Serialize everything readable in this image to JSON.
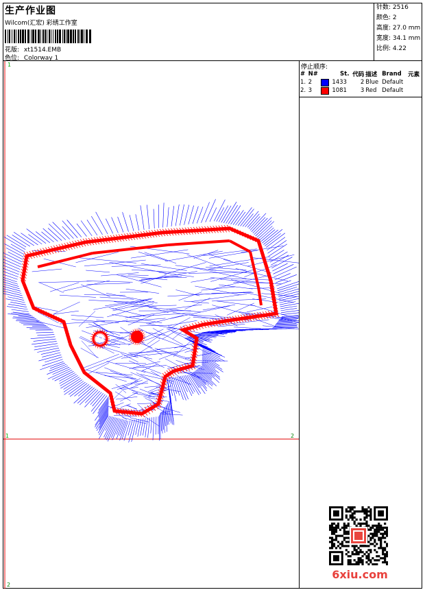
{
  "header": {
    "title": "生产作业图",
    "subtitle": "Wilcom(汇宏) 彩绣工作室",
    "design_label": "花版:",
    "design_value": "xt1514.EMB",
    "colorway_label": "色位:",
    "colorway_value": "Colorway 1"
  },
  "stats": {
    "stitches": "针数: 2516",
    "colors": "颜色: 2",
    "height": "高度: 27.0 mm",
    "width": "宽度: 34.1 mm",
    "ratio": "比例: 4.22"
  },
  "stop_sequence": {
    "caption": "停止顺序:",
    "headers": [
      "#",
      "N#",
      "St.",
      "代码",
      "描述",
      "Brand",
      "元素"
    ],
    "rows": [
      {
        "idx": "1.",
        "n": "2",
        "color": "#0000ff",
        "st": "1433",
        "code": "2",
        "desc": "Blue",
        "brand": "Default"
      },
      {
        "idx": "2.",
        "n": "3",
        "color": "#ff0000",
        "st": "1081",
        "code": "3",
        "desc": "Red",
        "brand": "Default"
      }
    ]
  },
  "canvas": {
    "mark_tl": "1",
    "mark_ml": "1",
    "mark_mr": "2",
    "mark_bl": "2",
    "crosshair_color": "#e00000",
    "grid_color": "#00aa00"
  },
  "colors": {
    "blue": "#0000ff",
    "red": "#ff0000"
  },
  "watermark": {
    "site": "6xiu.com"
  }
}
